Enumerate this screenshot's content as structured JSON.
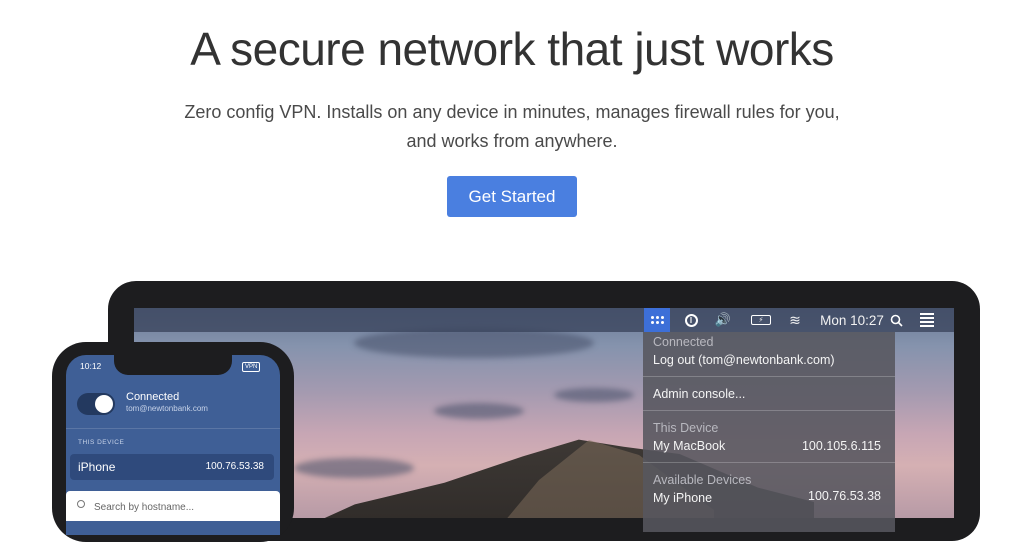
{
  "hero": {
    "title": "A secure network that just works",
    "subtitle": "Zero config VPN. Installs on any device in minutes, manages firewall rules for you, and works from anywhere.",
    "cta_label": "Get Started"
  },
  "menubar": {
    "icons": [
      "tailscale-icon",
      "1password-icon",
      "volume-icon",
      "battery-icon",
      "wifi-icon",
      "search-icon",
      "control-list-icon"
    ],
    "volume_glyph": "🔊",
    "battery_text": "⚡",
    "wifi_glyph": "≋",
    "clock": "Mon 10:27"
  },
  "dropdown": {
    "connected_label": "Connected",
    "logout": "Log out (tom@newtonbank.com)",
    "admin": "Admin console...",
    "this_device_label": "This Device",
    "this_device_name": "My MacBook",
    "this_device_ip": "100.105.6.115",
    "available_label": "Available Devices",
    "available": [
      {
        "name": "My iPhone",
        "ip": "100.76.53.38"
      }
    ]
  },
  "phone": {
    "time": "10:12",
    "vpn_badge": "VPN",
    "status": "Connected",
    "email": "tom@newtonbank.com",
    "section": "THIS DEVICE",
    "device_name": "iPhone",
    "device_ip": "100.76.53.38",
    "search_placeholder": "Search by hostname..."
  },
  "colors": {
    "accent": "#4a7fe0",
    "phone_bg": "#3f5f96",
    "menubar_highlight": "#3d6fd8"
  }
}
